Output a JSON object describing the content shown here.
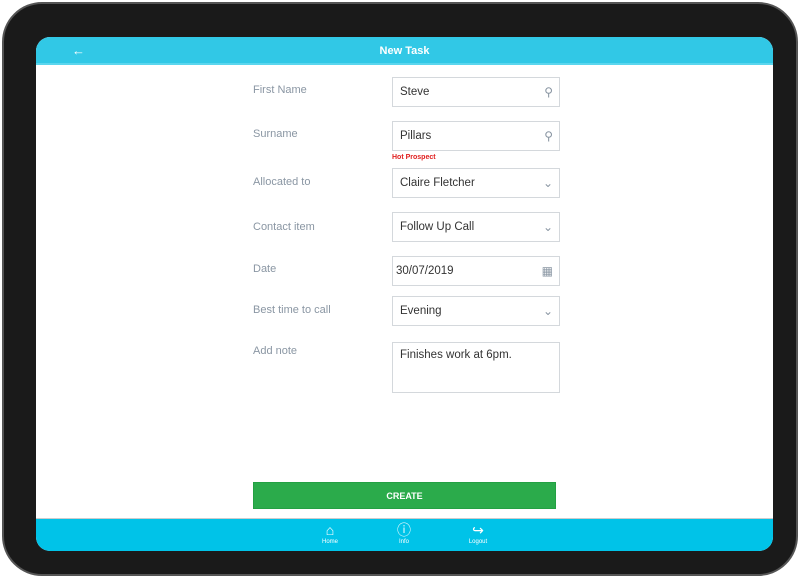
{
  "header": {
    "title": "New Task",
    "back_icon": "arrow-left-icon"
  },
  "form": {
    "first_name": {
      "label": "First Name",
      "value": "Steve"
    },
    "surname": {
      "label": "Surname",
      "value": "Pillars",
      "note": "Hot Prospect"
    },
    "allocated": {
      "label": "Allocated to",
      "value": "Claire Fletcher"
    },
    "contact": {
      "label": "Contact item",
      "value": "Follow Up Call"
    },
    "date": {
      "label": "Date",
      "value": "30/07/2019"
    },
    "best_time": {
      "label": "Best time to call",
      "value": "Evening"
    },
    "note": {
      "label": "Add note",
      "value": "Finishes work at 6pm."
    }
  },
  "create_label": "CREATE",
  "footer": {
    "home": "Home",
    "info": "Info",
    "logout": "Logout"
  },
  "colors": {
    "header": "#31c8e6",
    "footer": "#00c3e8",
    "create": "#2bab4b",
    "hot": "#e02020"
  }
}
